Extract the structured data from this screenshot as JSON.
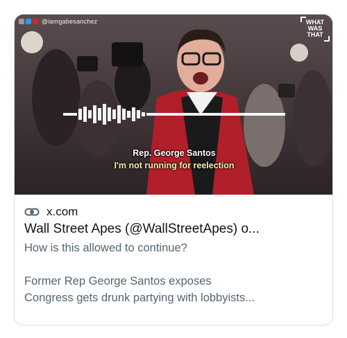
{
  "card": {
    "media": {
      "watermark_handle": "@iamgabesanchez",
      "logo_lines": [
        "WHAT",
        "WAS",
        "THAT"
      ],
      "caption_speaker": "Rep. George Santos",
      "caption_quote": "I'm not running for reelection"
    },
    "domain": "x.com",
    "title": "Wall Street Apes (@WallStreetApes) o...",
    "description_lines": [
      "How is this allowed to continue?",
      "",
      "Former Rep George Santos exposes",
      "Congress gets drunk partying with lobbyists..."
    ]
  },
  "icons": {
    "link": "link-icon"
  },
  "colors": {
    "border": "#dcdcdc",
    "text": "#0f1419",
    "secondary": "#536471",
    "jacket": "#b01f2a",
    "caption_quote": "#f2f2b0"
  }
}
